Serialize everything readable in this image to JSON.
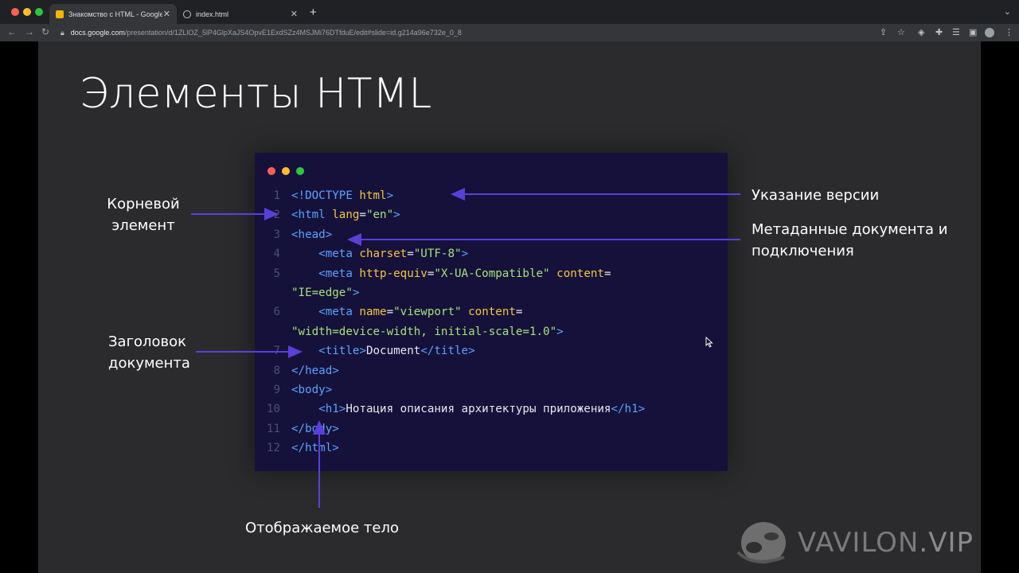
{
  "browser": {
    "tabs": [
      {
        "title": "Знакомство с HTML - Google",
        "active": true
      },
      {
        "title": "index.html",
        "active": false
      }
    ],
    "url_domain": "docs.google.com",
    "url_path": "/presentation/d/1ZLlOZ_5lP4GlpXaJS4OpvE1ExdSZz4MSJMi76DTfduE/edit#slide=id.g214a96e732e_0_8"
  },
  "slide": {
    "title": "Элементы HTML",
    "code_lines": [
      {
        "num": "1",
        "parts": [
          [
            "tag",
            "<!DOCTYPE "
          ],
          [
            "attr",
            "html"
          ],
          [
            "tag",
            ">"
          ]
        ]
      },
      {
        "num": "2",
        "parts": [
          [
            "tag",
            "<html "
          ],
          [
            "attr",
            "lang"
          ],
          [
            "txt",
            "="
          ],
          [
            "str",
            "\"en\""
          ],
          [
            "tag",
            ">"
          ]
        ]
      },
      {
        "num": "3",
        "parts": [
          [
            "tag",
            "<head>"
          ]
        ]
      },
      {
        "num": "4",
        "parts": [
          [
            "txt",
            "    "
          ],
          [
            "tag",
            "<meta "
          ],
          [
            "attr",
            "charset"
          ],
          [
            "txt",
            "="
          ],
          [
            "str",
            "\"UTF-8\""
          ],
          [
            "tag",
            ">"
          ]
        ]
      },
      {
        "num": "5",
        "parts": [
          [
            "txt",
            "    "
          ],
          [
            "tag",
            "<meta "
          ],
          [
            "attr",
            "http-equiv"
          ],
          [
            "txt",
            "="
          ],
          [
            "str",
            "\"X-UA-Compatible\""
          ],
          [
            "txt",
            " "
          ],
          [
            "attr",
            "content"
          ],
          [
            "txt",
            "="
          ]
        ]
      },
      {
        "num": "",
        "parts": [
          [
            "str",
            "\"IE=edge\""
          ],
          [
            "tag",
            ">"
          ]
        ]
      },
      {
        "num": "6",
        "parts": [
          [
            "txt",
            "    "
          ],
          [
            "tag",
            "<meta "
          ],
          [
            "attr",
            "name"
          ],
          [
            "txt",
            "="
          ],
          [
            "str",
            "\"viewport\""
          ],
          [
            "txt",
            " "
          ],
          [
            "attr",
            "content"
          ],
          [
            "txt",
            "="
          ]
        ]
      },
      {
        "num": "",
        "parts": [
          [
            "str",
            "\"width=device-width, initial-scale=1.0\""
          ],
          [
            "tag",
            ">"
          ]
        ]
      },
      {
        "num": "7",
        "parts": [
          [
            "txt",
            "    "
          ],
          [
            "tag",
            "<title>"
          ],
          [
            "txt",
            "Document"
          ],
          [
            "tag",
            "</title>"
          ]
        ]
      },
      {
        "num": "8",
        "parts": [
          [
            "tag",
            "</head>"
          ]
        ]
      },
      {
        "num": "9",
        "parts": [
          [
            "tag",
            "<body>"
          ]
        ]
      },
      {
        "num": "10",
        "parts": [
          [
            "txt",
            "    "
          ],
          [
            "tag",
            "<h1>"
          ],
          [
            "txt",
            "Нотация описания архитектуры приложения"
          ],
          [
            "tag",
            "</h1>"
          ]
        ]
      },
      {
        "num": "11",
        "parts": [
          [
            "tag",
            "</body>"
          ]
        ]
      },
      {
        "num": "12",
        "parts": [
          [
            "tag",
            "</html>"
          ]
        ]
      }
    ],
    "annotations": {
      "root_line1": "Корневой",
      "root_line2": "элемент",
      "version": "Указание версии",
      "meta_line1": "Метаданные документа и",
      "meta_line2": "подключения",
      "title_line1": "Заголовок",
      "title_line2": "документа",
      "body": "Отображаемое тело"
    },
    "colors": {
      "arrow": "#5b3fd9",
      "code_bg": "#15113a",
      "tag": "#5aa2ff",
      "attr": "#f5c542",
      "string": "#a6e17a"
    }
  },
  "watermark": {
    "text": "VAVILON",
    "suffix": ".VIP"
  }
}
